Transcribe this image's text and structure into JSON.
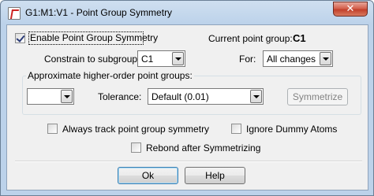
{
  "window": {
    "title": "G1:M1:V1 - Point Group Symmetry",
    "close_label": "✕"
  },
  "enable": {
    "label": "Enable Point Group Symmetry",
    "checked": true
  },
  "current_point_group": {
    "label": "Current point group:",
    "value": "C1"
  },
  "constrain": {
    "label": "Constrain to subgroup:",
    "value": "C1"
  },
  "for_field": {
    "label": "For:",
    "value": "All changes"
  },
  "approximate": {
    "group_label": "Approximate higher-order point groups:",
    "value": "",
    "tolerance_label": "Tolerance:",
    "tolerance_value": "Default (0.01)",
    "symmetrize_label": "Symmetrize"
  },
  "options": {
    "always_track": {
      "label": "Always track point group symmetry",
      "checked": false
    },
    "ignore_dummy": {
      "label": "Ignore Dummy Atoms",
      "checked": false
    },
    "rebond": {
      "label": "Rebond after Symmetrizing",
      "checked": false
    }
  },
  "footer": {
    "ok_label": "Ok",
    "help_label": "Help"
  }
}
